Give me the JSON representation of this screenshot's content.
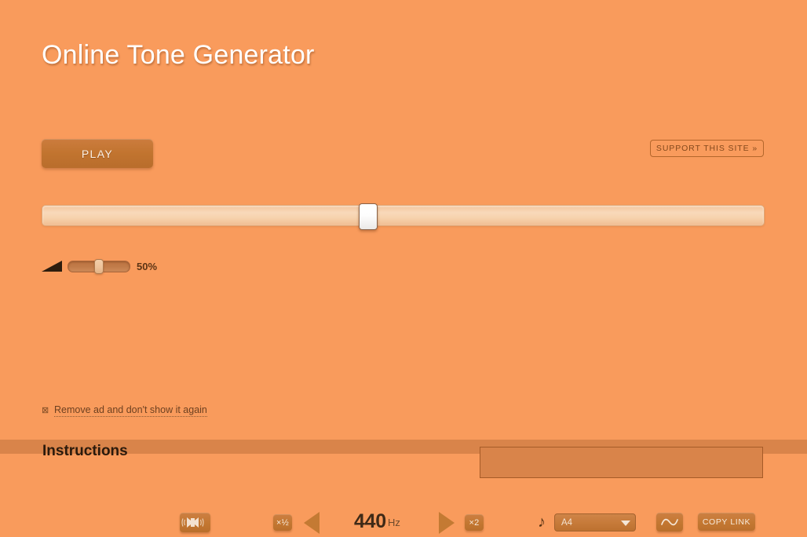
{
  "page": {
    "title": "Online Tone Generator",
    "background_color": "#f99b5c",
    "lower_background_color": "#d9844a"
  },
  "transport": {
    "play_label": "PLAY",
    "support_label": "SUPPORT THIS SITE »"
  },
  "frequency_slider": {
    "name": "frequency-slider",
    "value_percent": 44,
    "min": 20,
    "max": 20000
  },
  "volume": {
    "icon": "volume-wedge-icon",
    "slider_percent": 50,
    "level_label": "50%",
    "stereo_button_icon": "stereo-balance-icon"
  },
  "frequency": {
    "half_label": "×½",
    "decrement_icon": "triangle-left-icon",
    "value": "440",
    "unit": "Hz",
    "increment_icon": "triangle-right-icon",
    "double_label": "×2"
  },
  "note": {
    "icon": "music-note-icon",
    "selected": "A4",
    "options": [
      "A4"
    ],
    "caret_icon": "triangle-down-icon"
  },
  "waveform": {
    "icon": "sine-wave-icon",
    "selected": "sine"
  },
  "actions": {
    "copy_link_label": "COPY LINK"
  },
  "ad_notice": {
    "close_icon": "boxed-x-icon",
    "label": "Remove ad and don't show it again"
  },
  "bottom": {
    "instructions_heading": "Instructions"
  },
  "colors": {
    "accent_button": "#c37731",
    "button_text": "#f7e9da",
    "title_text": "#ffffff",
    "slider_track": "#f5d0a8",
    "slider_handle": "#ffffff",
    "dark_text": "#3f2a17",
    "link_text": "#6d4020"
  }
}
